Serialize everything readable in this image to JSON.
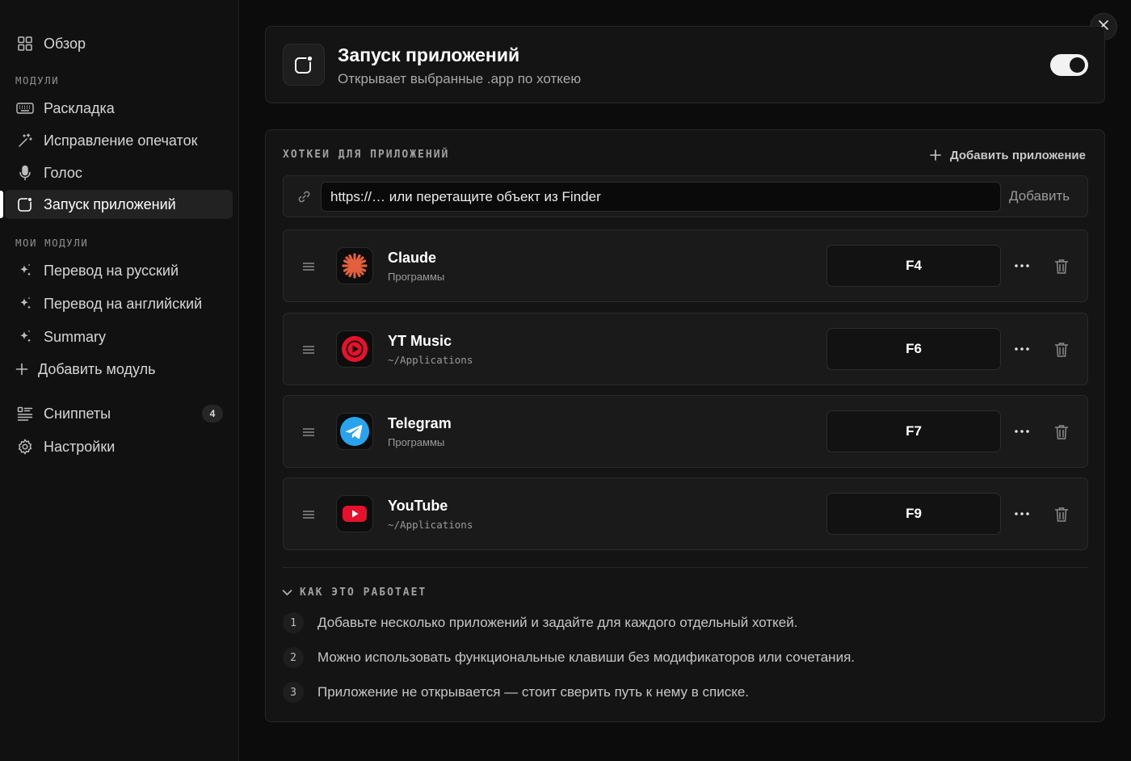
{
  "sidebar": {
    "overview": {
      "label": "Обзор",
      "icon": "grid-icon"
    },
    "modules_label": "МОДУЛИ",
    "modules": [
      {
        "label": "Раскладка",
        "icon": "keyboard-icon"
      },
      {
        "label": "Исправление опечаток",
        "icon": "magic-wand-icon"
      },
      {
        "label": "Голос",
        "icon": "microphone-icon"
      },
      {
        "label": "Запуск приложений",
        "icon": "app-launch-icon",
        "active": true
      }
    ],
    "my_modules_label": "МОИ МОДУЛИ",
    "my_modules": [
      {
        "label": "Перевод на русский",
        "icon": "sparkle-icon"
      },
      {
        "label": "Перевод на английский",
        "icon": "sparkle-icon"
      },
      {
        "label": "Summary",
        "icon": "sparkle-icon"
      }
    ],
    "add_module": "Добавить модуль",
    "snippets": {
      "label": "Сниппеты",
      "count": "4"
    },
    "settings": {
      "label": "Настройки"
    }
  },
  "header": {
    "title": "Запуск приложений",
    "subtitle": "Открывает выбранные .app по хоткею",
    "enabled": true
  },
  "hotkeys_section": {
    "label": "ХОТКЕИ ДЛЯ ПРИЛОЖЕНИЙ",
    "add_app": "Добавить приложение",
    "url_placeholder": "https://… или перетащите объект из Finder",
    "url_add": "Добавить",
    "apps": [
      {
        "name": "Claude",
        "path": "Программы",
        "hotkey": "F4",
        "icon": "claude-icon"
      },
      {
        "name": "YT Music",
        "path": "~/Applications",
        "hotkey": "F6",
        "icon": "yt-music-icon"
      },
      {
        "name": "Telegram",
        "path": "Программы",
        "hotkey": "F7",
        "icon": "telegram-icon"
      },
      {
        "name": "YouTube",
        "path": "~/Applications",
        "hotkey": "F9",
        "icon": "youtube-icon"
      }
    ]
  },
  "how_it_works": {
    "label": "КАК ЭТО РАБОТАЕТ",
    "steps": [
      {
        "num": "1",
        "text": "Добавьте несколько приложений и задайте для каждого отдельный хоткей."
      },
      {
        "num": "2",
        "text": "Можно использовать функциональные клавиши без модификаторов или сочетания."
      },
      {
        "num": "3",
        "text": "Приложение не открывается — стоит сверить путь к нему в списке."
      }
    ]
  },
  "colors": {
    "background": "#0c0c0c",
    "sidebar": "#111111",
    "card": "#141414",
    "claude_accent": "#e2603d",
    "yt_red": "#e8112d",
    "telegram_blue": "#2aa3ef"
  }
}
